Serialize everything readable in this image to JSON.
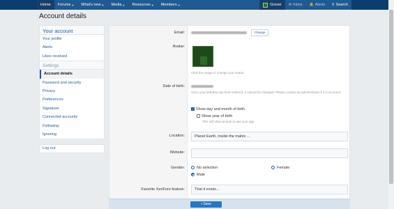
{
  "nav": {
    "items": [
      {
        "label": "Home",
        "chevron": false
      },
      {
        "label": "Forums",
        "chevron": true
      },
      {
        "label": "What's new",
        "chevron": true
      },
      {
        "label": "Media",
        "chevron": true
      },
      {
        "label": "Resources",
        "chevron": true
      },
      {
        "label": "Members",
        "chevron": true
      }
    ],
    "username": "Grover",
    "inbox": "Inbox",
    "alerts": "Alerts",
    "search": "Search"
  },
  "page": {
    "title": "Account details"
  },
  "sidebar": {
    "heading": "Your account",
    "account_items": [
      "Your profile",
      "Alerts",
      "Likes received"
    ],
    "settings_heading": "Settings",
    "settings_items": [
      "Account details",
      "Password and security",
      "Privacy",
      "Preferences",
      "Signature",
      "Connected accounts",
      "Following",
      "Ignoring"
    ],
    "active_item": "Account details",
    "logout": "Log out"
  },
  "form": {
    "email_label": "Email:",
    "change_button": "Change",
    "avatar_label": "Avatar:",
    "avatar_hint": "Click the image to change your avatar.",
    "dob_label": "Date of birth:",
    "dob_hint": "Once your birthday has been entered, it cannot be changed. Please contact an administrator if it is incorrect.",
    "show_day_month": "Show day and month of birth",
    "show_year": "Show year of birth",
    "show_year_hint": "This will allow people to see your age.",
    "location_label": "Location:",
    "location_value": "Planet Earth, inside the matrix ...",
    "website_label": "Website:",
    "website_value": "",
    "gender_label": "Gender:",
    "gender_options": [
      "No selection",
      "Female",
      "Male"
    ],
    "gender_selected": "Male",
    "xenforo_label": "Favorite XenForo feature:",
    "xenforo_value": "That it exists...",
    "save_button": "Save"
  },
  "colors": {
    "header_dark": "#0b3d6e",
    "nav": "#1f5a93",
    "accent": "#2577c8"
  }
}
